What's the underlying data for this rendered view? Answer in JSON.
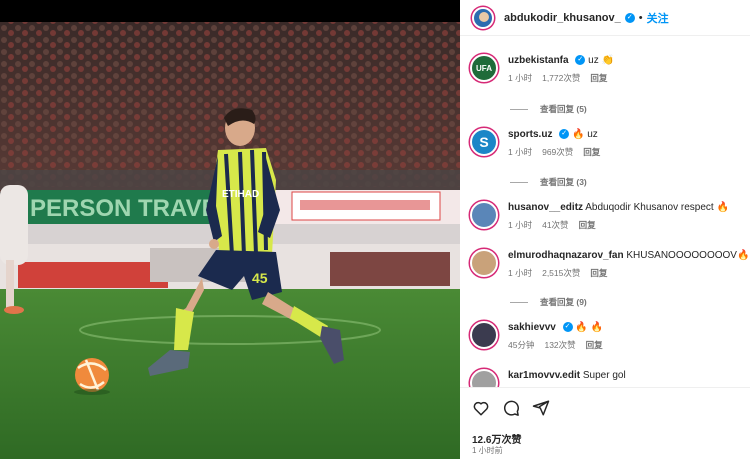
{
  "header": {
    "username": "abdukodir_khusanov_",
    "separator": "•",
    "follow_label": "关注"
  },
  "player": {
    "shirt_sponsor": "ETIHAD",
    "shirt_number": "45"
  },
  "banners": {
    "sign_text": "PERSON TRAVEL.C"
  },
  "comments": [
    {
      "username": "uzbekistanfa",
      "text": "uz",
      "emoji": "👏",
      "time": "1 小时",
      "likes": "1,772次赞",
      "reply": "回复",
      "avatar_text": "UFA",
      "avatar_color": "#1f6b3a"
    },
    {
      "username": "sports.uz",
      "text": "uz",
      "emoji": "🔥",
      "time": "1 小时",
      "likes": "969次赞",
      "reply": "回复",
      "avatar_text": "S",
      "avatar_color": "#1b86c7"
    },
    {
      "username": "husanov__editz",
      "text": "Abduqodir Khusanov respect",
      "emoji": "🔥",
      "time": "1 小时",
      "likes": "41次赞",
      "reply": "回复",
      "avatar_text": "",
      "avatar_color": "#5a86b8"
    },
    {
      "username": "elmurodhaqnazarov_fan",
      "text": "KHUSANOOOOOOOOV",
      "emoji": "🔥",
      "time": "1 小时",
      "likes": "2,515次赞",
      "reply": "回复",
      "avatar_text": "",
      "avatar_color": "#c9a27a"
    },
    {
      "username": "sakhievvv",
      "text": "",
      "emoji": "🔥 🔥",
      "time": "45分钟",
      "likes": "132次赞",
      "reply": "回复",
      "avatar_text": "",
      "avatar_color": "#3b3b4f"
    },
    {
      "username": "kar1movvv.edit",
      "text": "Super gol",
      "emoji": "",
      "avatar_text": "",
      "avatar_color": "#a0a0a0"
    }
  ],
  "view_replies": [
    {
      "label": "查看回复 (5)"
    },
    {
      "label": "查看回复 (3)"
    },
    {
      "label": "查看回复 (9)"
    }
  ],
  "footer": {
    "likes": "12.6万次赞",
    "time": "1 小时前"
  },
  "colors": {
    "accent": "#0095f6",
    "pitch": "#3d7a2e",
    "city_yellow": "#d7e84a",
    "city_navy": "#1b2a4e"
  },
  "icons": [
    "heart-icon",
    "comment-icon",
    "share-icon",
    "verified-icon"
  ]
}
